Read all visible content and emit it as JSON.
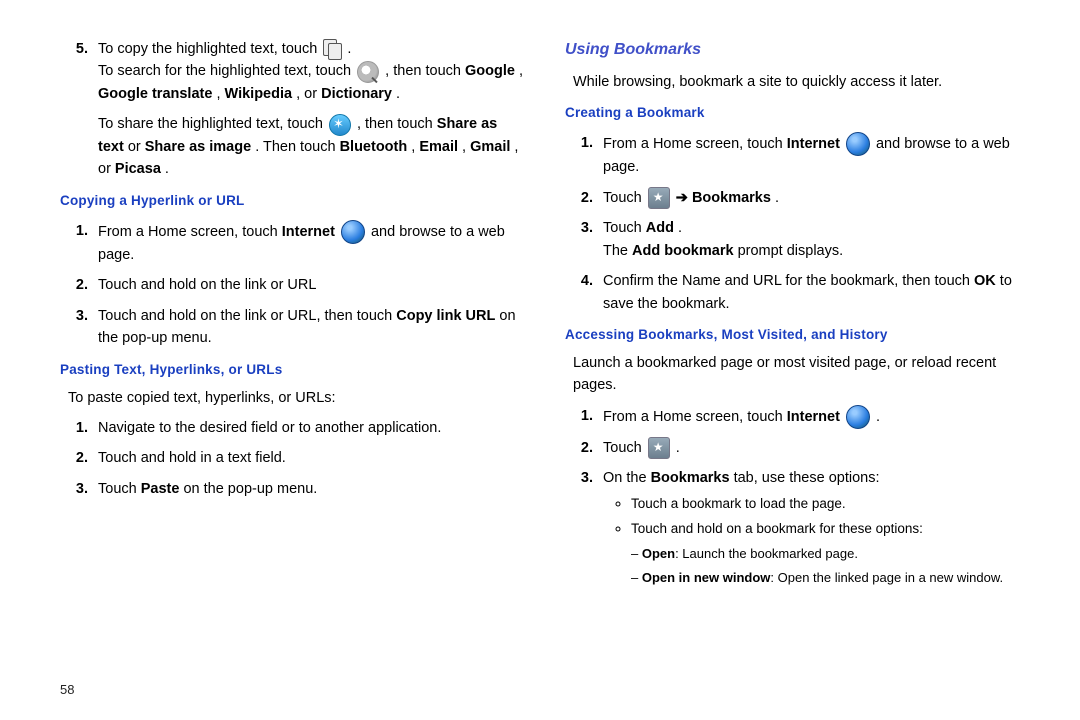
{
  "pageNumber": "58",
  "left": {
    "step5": {
      "num": "5.",
      "l1a": "To copy the highlighted text, touch ",
      "l1b": " .",
      "l2a": "To search for the highlighted text, touch ",
      "l2b": " , then touch ",
      "l2c": "Google",
      "l2d": ", ",
      "l2e": "Google translate",
      "l2f": ", ",
      "l2g": "Wikipedia",
      "l2h": ", or ",
      "l2i": "Dictionary",
      "l2j": ".",
      "l3a": "To share the highlighted text, touch ",
      "l3b": " , then touch ",
      "l3c": "Share as text",
      "l3d": " or ",
      "l3e": "Share as image",
      "l3f": ". Then touch ",
      "l3g": "Bluetooth",
      "l3h": ", ",
      "l3i": "Email",
      "l3j": ", ",
      "l3k": "Gmail",
      "l3l": ", or ",
      "l3m": "Picasa",
      "l3n": "."
    },
    "copyHead": "Copying a Hyperlink or URL",
    "copy": {
      "s1n": "1.",
      "s1a": "From a Home screen, touch ",
      "s1b": "Internet",
      "s1c": " and browse to a web page.",
      "s2n": "2.",
      "s2": "Touch and hold on the link or URL",
      "s3n": "3.",
      "s3a": "Touch and hold on the link or URL, then touch ",
      "s3b": "Copy link URL",
      "s3c": " on the pop-up menu."
    },
    "pasteHead": "Pasting Text, Hyperlinks, or URLs",
    "pasteIntro": "To paste copied text, hyperlinks, or URLs:",
    "paste": {
      "s1n": "1.",
      "s1": "Navigate to the desired field or to another application.",
      "s2n": "2.",
      "s2": "Touch and hold in a text field.",
      "s3n": "3.",
      "s3a": "Touch ",
      "s3b": "Paste",
      "s3c": " on the pop-up menu."
    }
  },
  "right": {
    "usingHead": "Using Bookmarks",
    "usingIntro": "While browsing, bookmark a site to quickly access it later.",
    "createHead": "Creating a Bookmark",
    "create": {
      "s1n": "1.",
      "s1a": "From a Home screen, touch ",
      "s1b": "Internet",
      "s1c": " and browse to a web page.",
      "s2n": "2.",
      "s2a": "Touch ",
      "s2arrow": " ➔ ",
      "s2b": "Bookmarks",
      "s2c": ".",
      "s3n": "3.",
      "s3a": "Touch ",
      "s3b": "Add",
      "s3c": ".",
      "s3d": "The ",
      "s3e": "Add bookmark",
      "s3f": " prompt displays.",
      "s4n": "4.",
      "s4a": "Confirm the Name and URL for the bookmark, then touch ",
      "s4b": "OK",
      "s4c": " to save the bookmark."
    },
    "accessHead": "Accessing Bookmarks, Most Visited, and History",
    "accessIntro": "Launch a bookmarked page or most visited page, or reload recent pages.",
    "access": {
      "s1n": "1.",
      "s1a": "From a Home screen, touch ",
      "s1b": "Internet",
      "s1c": " .",
      "s2n": "2.",
      "s2a": "Touch ",
      "s2b": " .",
      "s3n": "3.",
      "s3a": "On the ",
      "s3b": "Bookmarks",
      "s3c": " tab, use these options:",
      "b1": "Touch a bookmark to load the page.",
      "b2": "Touch and hold on a bookmark for these options:",
      "d1a": "Open",
      "d1b": ": Launch the bookmarked page.",
      "d2a": "Open in new window",
      "d2b": ": Open the linked page in a new window."
    }
  }
}
